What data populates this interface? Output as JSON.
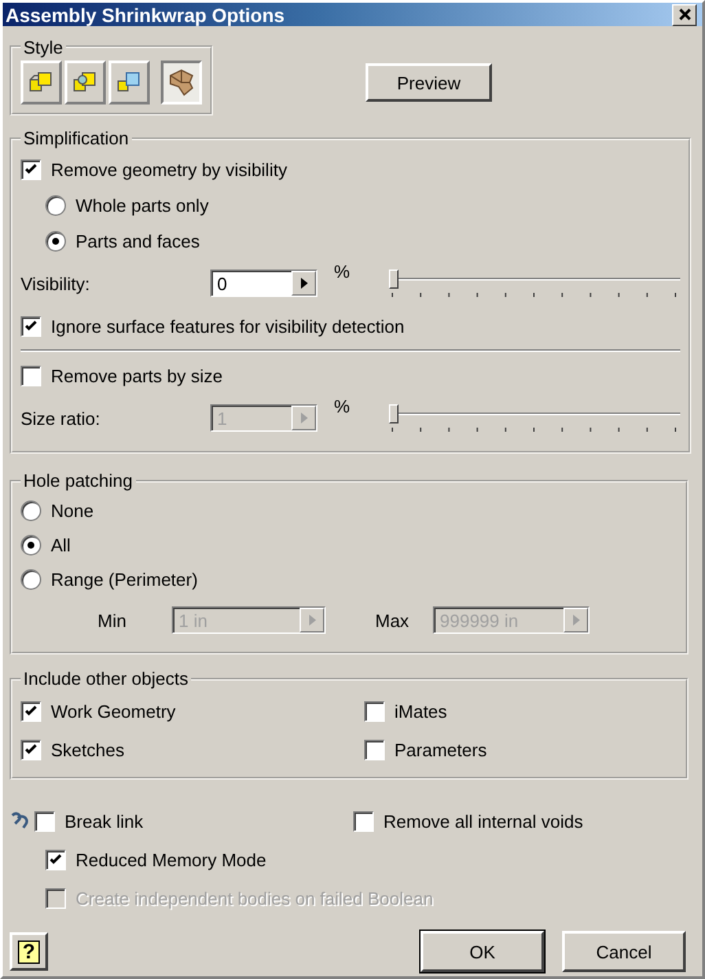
{
  "window": {
    "title": "Assembly Shrinkwrap Options"
  },
  "style": {
    "label": "Style",
    "buttons": [
      {
        "kind": "solid",
        "selected": false
      },
      {
        "kind": "swept",
        "selected": false
      },
      {
        "kind": "outline",
        "selected": false
      },
      {
        "kind": "surface",
        "selected": true
      }
    ]
  },
  "preview": "Preview",
  "simplification": {
    "label": "Simplification",
    "remove_by_visibility": {
      "label": "Remove geometry by visibility",
      "checked": true
    },
    "options": [
      {
        "label": "Whole parts only",
        "selected": false
      },
      {
        "label": "Parts and faces",
        "selected": true
      }
    ],
    "visibility": {
      "label": "Visibility:",
      "value": "0",
      "unit": "%",
      "level": 0,
      "disabled": false
    },
    "ignore_surface": {
      "label": "Ignore surface features for visibility detection",
      "checked": true
    },
    "remove_by_size": {
      "label": "Remove parts by size",
      "checked": false
    },
    "size_ratio": {
      "label": "Size ratio:",
      "value": "1",
      "unit": "%",
      "level": 0,
      "disabled": true
    }
  },
  "hole_patching": {
    "label": "Hole patching",
    "options": [
      {
        "label": "None",
        "selected": false
      },
      {
        "label": "All",
        "selected": true
      },
      {
        "label": "Range (Perimeter)",
        "selected": false
      }
    ],
    "min": {
      "label": "Min",
      "value": "1 in",
      "disabled": true
    },
    "max": {
      "label": "Max",
      "value": "999999 in",
      "disabled": true
    }
  },
  "include": {
    "label": "Include other objects",
    "items": [
      {
        "label": "Work Geometry",
        "checked": true
      },
      {
        "label": "iMates",
        "checked": false
      },
      {
        "label": "Sketches",
        "checked": true
      },
      {
        "label": "Parameters",
        "checked": false
      }
    ]
  },
  "options": {
    "break_link": {
      "label": "Break link",
      "checked": false
    },
    "remove_voids": {
      "label": "Remove all internal voids",
      "checked": false
    },
    "reduced_memory": {
      "label": "Reduced Memory Mode",
      "checked": true
    },
    "independent_bodies": {
      "label": "Create independent bodies on failed Boolean",
      "checked": false,
      "disabled": true
    }
  },
  "help": "?",
  "buttons": [
    {
      "label": "OK",
      "default": true
    },
    {
      "label": "Cancel",
      "default": false
    }
  ]
}
